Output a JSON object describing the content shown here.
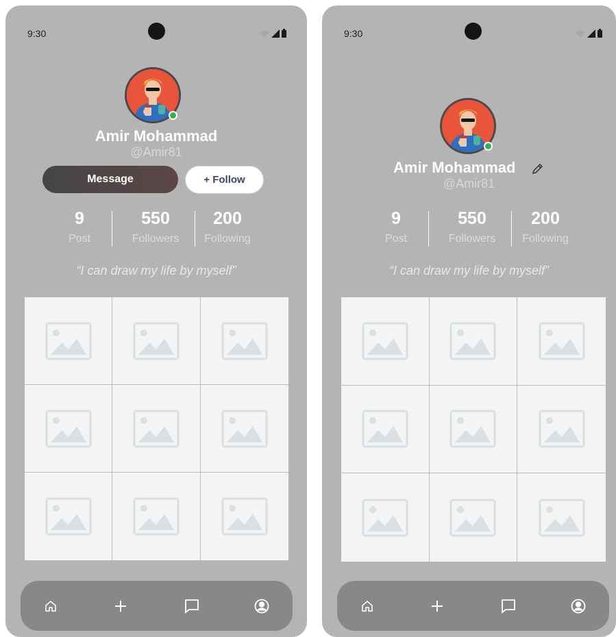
{
  "screens": [
    {
      "status": {
        "time": "9:30"
      },
      "profile": {
        "name": "Amir Mohammad",
        "handle": "@Amir81",
        "quote": "“I can draw my life by myself”"
      },
      "actions": {
        "message_label": "Message",
        "follow_label": "+ Follow"
      },
      "stats": [
        {
          "value": "9",
          "label": "Post"
        },
        {
          "value": "550",
          "label": "Followers"
        },
        {
          "value": "200",
          "label": "Following"
        }
      ],
      "grid_count": 9,
      "nav": [
        "home-icon",
        "plus-icon",
        "chat-icon",
        "profile-icon"
      ]
    },
    {
      "status": {
        "time": "9:30"
      },
      "profile": {
        "name": "Amir Mohammad",
        "handle": "@Amir81",
        "quote": "“I can draw my life by myself”"
      },
      "stats": [
        {
          "value": "9",
          "label": "Post"
        },
        {
          "value": "550",
          "label": "Followers"
        },
        {
          "value": "200",
          "label": "Following"
        }
      ],
      "grid_count": 9,
      "nav": [
        "home-icon",
        "plus-icon",
        "chat-icon",
        "profile-icon"
      ]
    }
  ],
  "colors": {
    "screen_bg": "#b4b4b4",
    "navbar_bg": "#888888",
    "online": "#2fb451",
    "grid_bg": "#f2f4f5"
  }
}
